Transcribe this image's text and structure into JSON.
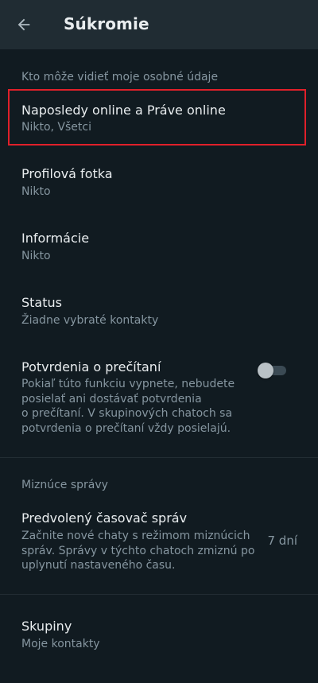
{
  "header": {
    "title": "Súkromie",
    "back_icon": "arrow-left-icon"
  },
  "sections": {
    "personal_info": {
      "header": "Kto môže vidieť moje osobné údaje",
      "last_seen": {
        "title": "Naposledy online a Práve online",
        "subtitle": "Nikto, Všetci"
      },
      "profile_photo": {
        "title": "Profilová fotka",
        "subtitle": "Nikto"
      },
      "about": {
        "title": "Informácie",
        "subtitle": "Nikto"
      },
      "status": {
        "title": "Status",
        "subtitle": "Žiadne vybraté kontakty"
      },
      "read_receipts": {
        "title": "Potvrdenia o prečítaní",
        "subtitle_lines": [
          "Pokiaľ túto funkciu vypnete, nebudete",
          "posielať ani dostávať potvrdenia",
          "o prečítaní. V skupinových chatoch sa",
          "potvrdenia o prečítaní vždy posielajú."
        ],
        "enabled": false
      }
    },
    "disappearing": {
      "header": "Miznúce správy",
      "default_timer": {
        "title": "Predvolený časovač správ",
        "subtitle_lines": [
          "Začnite nové chaty s režimom miznúcich",
          "správ. Správy v týchto chatoch zmiznú po",
          "uplynutí nastaveného času."
        ],
        "value": "7 dní"
      }
    },
    "groups": {
      "title": "Skupiny",
      "subtitle": "Moje kontakty"
    }
  },
  "colors": {
    "background": "#111b21",
    "app_bar": "#202c33",
    "primary_text": "#e9edef",
    "secondary_text": "#8696a0",
    "highlight_border": "#e0202a"
  }
}
